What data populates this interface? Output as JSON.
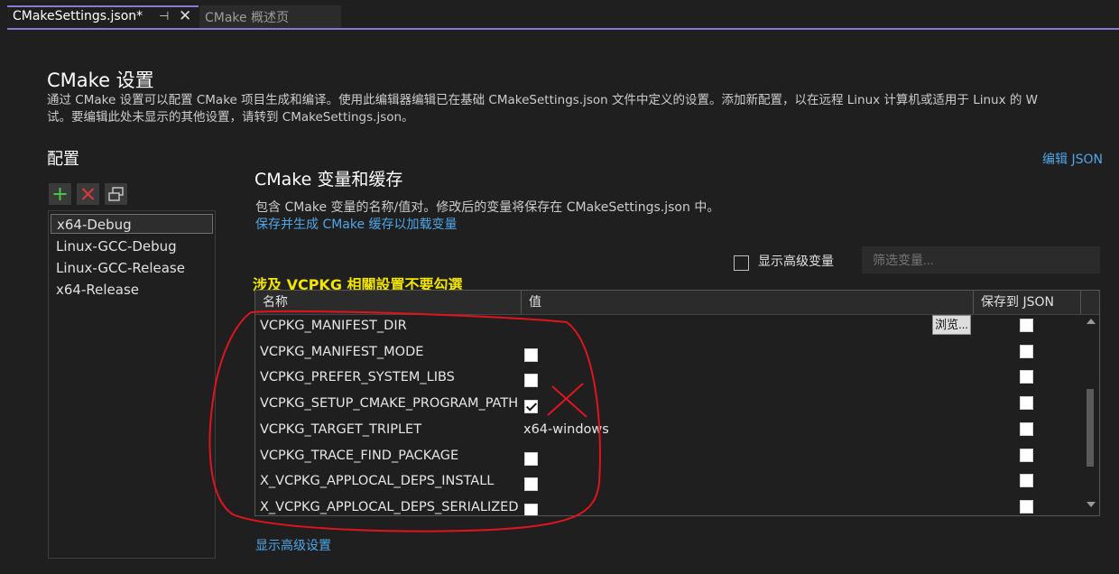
{
  "tabs": {
    "active": {
      "label": "CMakeSettings.json*",
      "pin_icon": "pin-icon",
      "close_icon": "close-icon"
    },
    "inactive": {
      "label": "CMake 概述页"
    }
  },
  "colors": {
    "accent": "#8b7ad4",
    "link": "#4fa6e8",
    "annotation": "#f2e600",
    "markup_red": "#e0141e"
  },
  "page": {
    "title": "CMake 设置",
    "description_line1": "通过 CMake 设置可以配置 CMake 项目生成和编译。使用此编辑器编辑已在基础 CMakeSettings.json 文件中定义的设置。添加新配置，以在远程 Linux 计算机或适用于 Linux 的 W",
    "description_line2": "试。要编辑此处未显示的其他设置，请转到 CMakeSettings.json。"
  },
  "configurations": {
    "title": "配置",
    "toolbar": [
      "add-icon",
      "delete-icon",
      "copy-icon"
    ],
    "items": [
      "x64-Debug",
      "Linux-GCC-Debug",
      "Linux-GCC-Release",
      "x64-Release"
    ],
    "selected": "x64-Debug"
  },
  "edit_json_link": "编辑 JSON",
  "variables": {
    "title": "CMake 变量和缓存",
    "description": "包含 CMake 变量的名称/值对。修改后的变量将保存在 CMakeSettings.json 中。",
    "save_link": "保存并生成 CMake 缓存以加载变量",
    "show_advanced_label": "显示高级变量",
    "show_advanced_checked": false,
    "filter_placeholder": "筛选变量...",
    "annotation": "涉及 VCPKG 相關設置不要勾選",
    "columns": {
      "name": "名称",
      "value": "值",
      "save": "保存到 JSON"
    },
    "browse_label": "浏览...",
    "rows": [
      {
        "name": "VCPKG_MANIFEST_DIR",
        "type": "path",
        "value": ""
      },
      {
        "name": "VCPKG_MANIFEST_MODE",
        "type": "bool",
        "checked": false
      },
      {
        "name": "VCPKG_PREFER_SYSTEM_LIBS",
        "type": "bool",
        "checked": false
      },
      {
        "name": "VCPKG_SETUP_CMAKE_PROGRAM_PATH",
        "type": "bool",
        "checked": true
      },
      {
        "name": "VCPKG_TARGET_TRIPLET",
        "type": "text",
        "value": "x64-windows"
      },
      {
        "name": "VCPKG_TRACE_FIND_PACKAGE",
        "type": "bool",
        "checked": false
      },
      {
        "name": "X_VCPKG_APPLOCAL_DEPS_INSTALL",
        "type": "bool",
        "checked": false
      },
      {
        "name": "X_VCPKG_APPLOCAL_DEPS_SERIALIZED",
        "type": "bool",
        "checked": false
      }
    ]
  },
  "show_advanced_settings_link": "显示高级设置"
}
